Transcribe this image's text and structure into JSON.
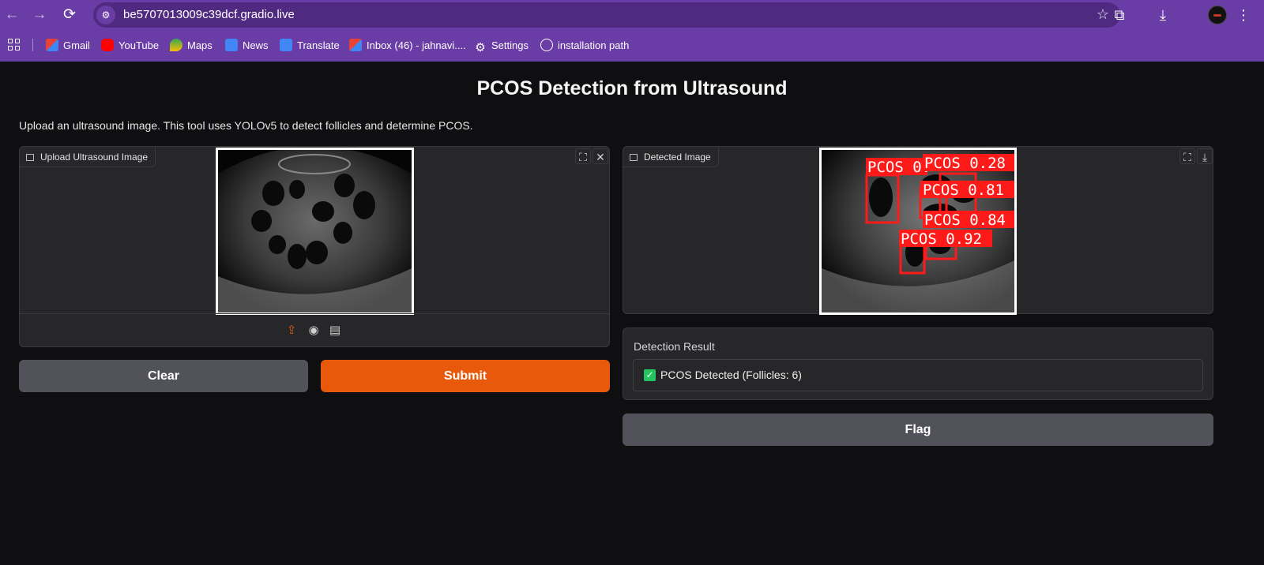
{
  "browser": {
    "url": "be5707013009c39dcf.gradio.live",
    "bookmarks": [
      {
        "label": "Gmail",
        "icon": "gmail-icon",
        "color": "#ea4335"
      },
      {
        "label": "YouTube",
        "icon": "youtube-icon",
        "color": "#ff0000"
      },
      {
        "label": "Maps",
        "icon": "maps-icon",
        "color": "#34a853"
      },
      {
        "label": "News",
        "icon": "news-icon",
        "color": "#4285f4"
      },
      {
        "label": "Translate",
        "icon": "translate-icon",
        "color": "#4285f4"
      },
      {
        "label": "Inbox (46) - jahnavi....",
        "icon": "gmail-icon",
        "color": "#ea4335"
      },
      {
        "label": "Settings",
        "icon": "gear-icon",
        "color": "#ffffff"
      },
      {
        "label": "installation path",
        "icon": "globe-icon",
        "color": "#ffffff"
      }
    ]
  },
  "app": {
    "title": "PCOS Detection from Ultrasound",
    "description": "Upload an ultrasound image. This tool uses YOLOv5 to detect follicles and determine PCOS.",
    "input_panel": {
      "label": "Upload Ultrasound Image"
    },
    "output_panel": {
      "label": "Detected Image"
    },
    "clear_label": "Clear",
    "submit_label": "Submit",
    "result": {
      "label": "Detection Result",
      "value": "PCOS Detected (Follicles: 6)"
    },
    "flag_label": "Flag",
    "detections": [
      {
        "label": "PCOS 0.",
        "conf": null
      },
      {
        "label": "PCOS 0.28",
        "conf": 0.28
      },
      {
        "label": "PCOS 0.81",
        "conf": 0.81
      },
      {
        "label": "PCOS 0.84",
        "conf": 0.84
      },
      {
        "label": "PCOS 0.92",
        "conf": 0.92
      }
    ]
  },
  "colors": {
    "accent": "#e8590c",
    "secondary": "#52525b",
    "browser": "#6a3ca6",
    "success": "#22c55e",
    "detection": "#ff1a1a"
  }
}
